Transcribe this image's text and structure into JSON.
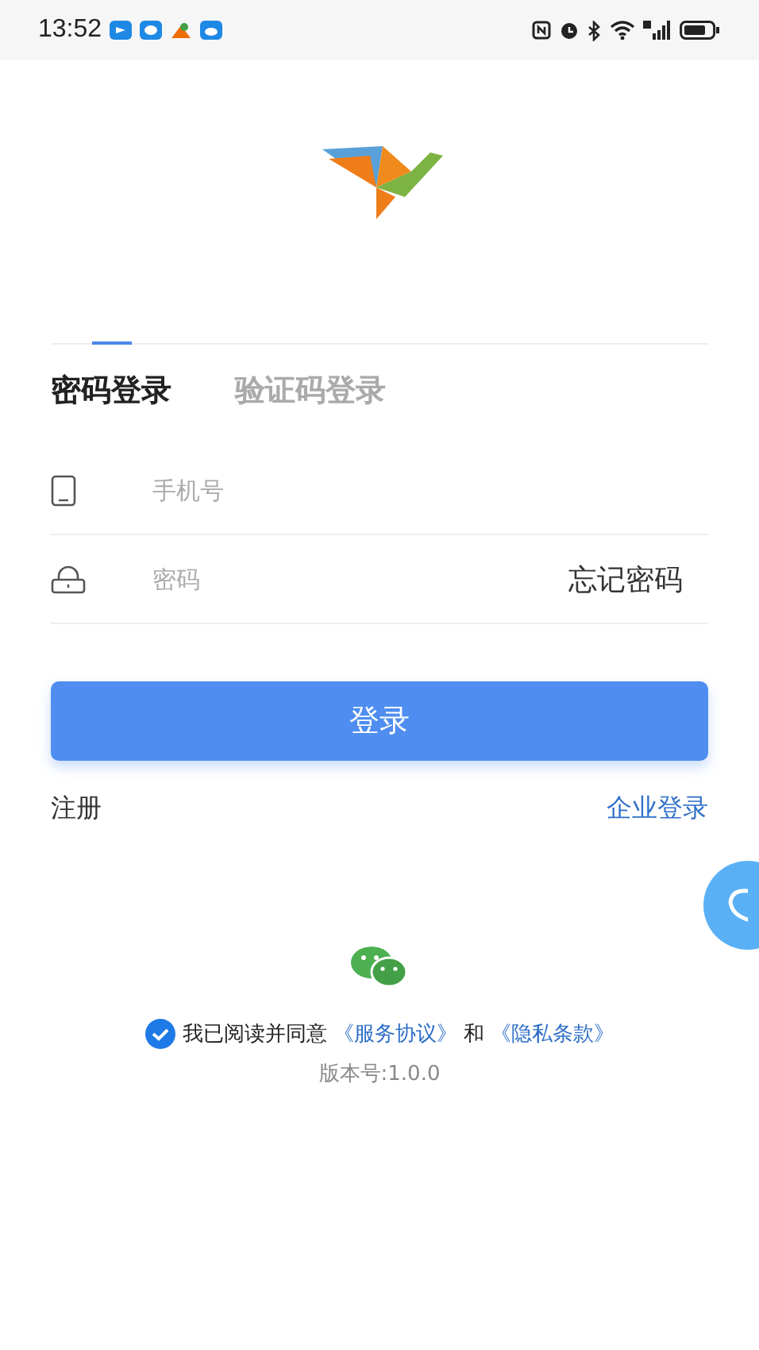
{
  "status_bar": {
    "time": "13:52"
  },
  "tabs": [
    {
      "label": "密码登录",
      "selected": true
    },
    {
      "label": "验证码登录",
      "selected": false
    }
  ],
  "fields": [
    {
      "kind": "phone",
      "placeholder": "手机号"
    },
    {
      "kind": "password",
      "placeholder": "密码",
      "action": "忘记密码"
    }
  ],
  "login_button": "登录",
  "links": {
    "register": "注册",
    "enterprise_login": "企业登录"
  },
  "agreement": {
    "checked": true,
    "text": "我已阅读并同意",
    "service_link": "《服务协议》",
    "and": "和",
    "privacy_link": "《隐私条款》"
  },
  "version": "版本号:1.0.0"
}
